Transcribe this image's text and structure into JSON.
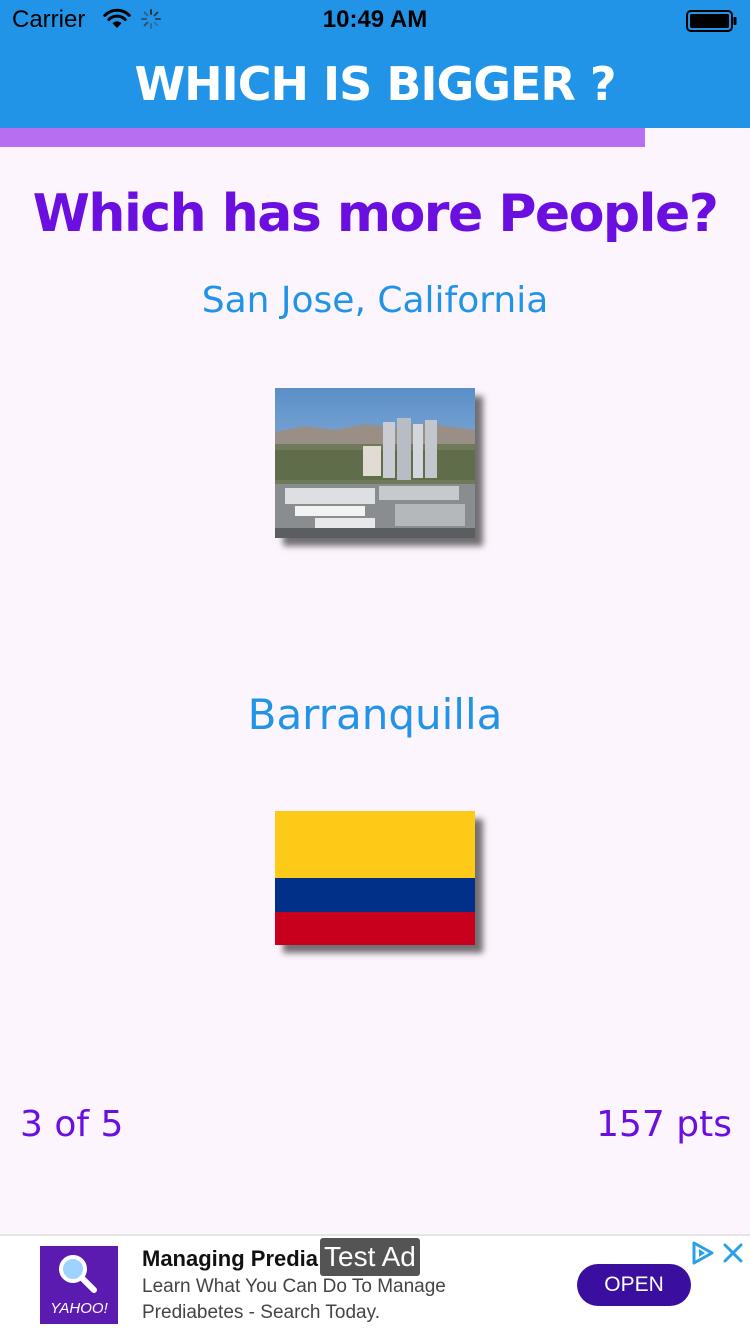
{
  "status_bar": {
    "carrier": "Carrier",
    "time": "10:49 AM",
    "icons": [
      "wifi-icon",
      "activity-spinner-icon",
      "battery-icon"
    ]
  },
  "header": {
    "title": "WHICH IS BIGGER ?",
    "background_color": "#2194e8"
  },
  "round_progress": {
    "fraction": 0.86,
    "color": "#b86ef0"
  },
  "question": {
    "text": "Which has more People?",
    "color": "#6a0fe0"
  },
  "options": [
    {
      "name": "San Jose, California",
      "image": "city-skyline-photo"
    },
    {
      "name": "Barranquilla",
      "image": "colombia-flag",
      "flag_colors": [
        "#fcca17",
        "#003087",
        "#c8001e"
      ]
    }
  ],
  "footer": {
    "question_progress": "3 of 5",
    "score": "157 pts"
  },
  "ad": {
    "advertiser_logo_text": "YAHOO!",
    "headline": "Managing Predia",
    "body": "Learn What You Can Do To Manage Prediabetes - Search Today.",
    "test_label": "Test Ad",
    "cta": "OPEN",
    "icons": [
      "search-icon",
      "adchoices-icon",
      "close-icon"
    ]
  },
  "colors": {
    "page_background": "#fdf5fd",
    "accent_purple": "#6a0fe0",
    "accent_blue": "#2194e8"
  }
}
